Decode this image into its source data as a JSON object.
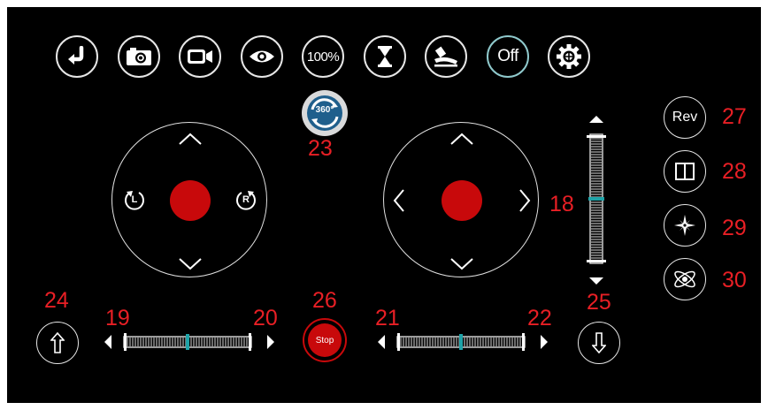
{
  "top_bar": {
    "buttons": [
      {
        "name": "back-button",
        "icon": "return-arrow-icon"
      },
      {
        "name": "photo-button",
        "icon": "camera-icon"
      },
      {
        "name": "video-button",
        "icon": "video-camera-icon"
      },
      {
        "name": "vr-view-button",
        "icon": "vr-glasses-icon"
      },
      {
        "name": "speed-button",
        "label": "100%"
      },
      {
        "name": "altitude-hold-button",
        "icon": "hourglass-icon"
      },
      {
        "name": "calibrate-button",
        "icon": "level-icon"
      },
      {
        "name": "headless-toggle-button",
        "label": "Off"
      },
      {
        "name": "settings-button",
        "icon": "gear-icon"
      }
    ]
  },
  "flip_button": {
    "label": "360°",
    "icon": "rotate-360-icon"
  },
  "left_stick": {
    "left_label": "L",
    "right_label": "R"
  },
  "stop_button": {
    "label": "Stop"
  },
  "side_buttons": {
    "rev_label": "Rev",
    "split_icon": "split-screen-icon",
    "compass_icon": "compass-icon",
    "gyro_icon": "gyro-orbit-icon"
  },
  "markers": {
    "m18": "18",
    "m19": "19",
    "m20": "20",
    "m21": "21",
    "m22": "22",
    "m23": "23",
    "m24": "24",
    "m25": "25",
    "m26": "26",
    "m27": "27",
    "m28": "28",
    "m29": "29",
    "m30": "30"
  },
  "colors": {
    "background": "#000000",
    "accent_red": "#c8090b",
    "marker_red": "#e81f25",
    "trim_indicator": "#1fa3a8"
  },
  "trims": {
    "vertical_trim_level": 0.5,
    "left_horizontal_trim_level": 0.5,
    "right_horizontal_trim_level": 0.5
  }
}
